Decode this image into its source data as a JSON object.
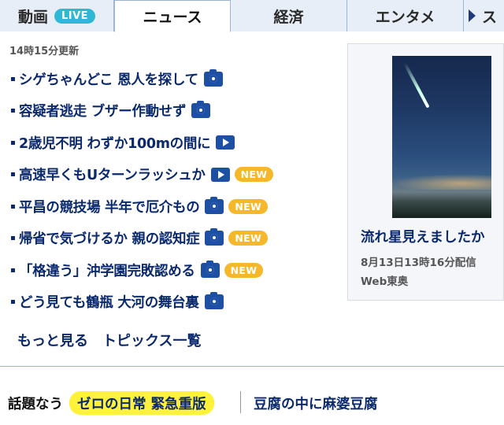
{
  "tabs": [
    {
      "label": "動画",
      "badge": "LIVE"
    },
    {
      "label": "ニュース"
    },
    {
      "label": "経済"
    },
    {
      "label": "エンタメ"
    },
    {
      "label": "ス"
    }
  ],
  "updated": "14時15分更新",
  "headlines": [
    {
      "text": "シゲちゃんどこ 恩人を探して",
      "icon": "camera-icon"
    },
    {
      "text": "容疑者逃走 ブザー作動せず",
      "icon": "camera-icon"
    },
    {
      "text": "2歳児不明 わずか100mの間に",
      "icon": "video-icon"
    },
    {
      "text": "高速早くもUターンラッシュか",
      "icon": "video-icon",
      "badge": "NEW"
    },
    {
      "text": "平昌の競技場 半年で厄介もの",
      "icon": "camera-icon",
      "badge": "NEW"
    },
    {
      "text": "帰省で気づけるか 親の認知症",
      "icon": "camera-icon",
      "badge": "NEW"
    },
    {
      "text": "「格違う」沖学園完敗認める",
      "icon": "camera-icon",
      "badge": "NEW"
    },
    {
      "text": "どう見ても鶴瓶 大河の舞台裏",
      "icon": "camera-icon"
    }
  ],
  "more_links": {
    "more": "もっと見る",
    "topics": "トピックス一覧"
  },
  "feature": {
    "title": "流れ星見えましたか",
    "date": "8月13日13時16分配信",
    "source": "Web東奥"
  },
  "trending": {
    "label": "話題なう",
    "highlight": "ゼロの日常 緊急重版",
    "item": "豆腐の中に麻婆豆腐"
  },
  "colors": {
    "link": "#0b2a6e",
    "icon": "#1d4fa3",
    "live_badge": "#2fb7d6",
    "new_badge": "#f4b82a",
    "tab_bg": "#e8eef8",
    "highlight": "#fff23a"
  }
}
